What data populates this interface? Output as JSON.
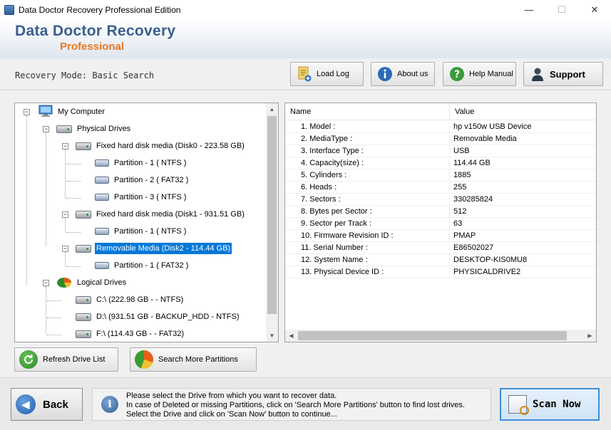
{
  "window": {
    "title": "Data Doctor Recovery Professional Edition",
    "min": "—",
    "max": "☐",
    "close": "✕"
  },
  "brand": {
    "name": "Data Doctor Recovery",
    "edition": "Professional"
  },
  "mode": {
    "text": "Recovery Mode: Basic Search"
  },
  "toolbar": {
    "load_log": "Load Log",
    "about": "About us",
    "help": "Help Manual",
    "support": "Support"
  },
  "tree": {
    "my_computer": "My Computer",
    "physical_drives": "Physical Drives",
    "disk0": "Fixed hard disk media (Disk0 - 223.58 GB)",
    "disk0_p1": "Partition - 1 ( NTFS )",
    "disk0_p2": "Partition - 2 ( FAT32 )",
    "disk0_p3": "Partition - 3 ( NTFS )",
    "disk1": "Fixed hard disk media (Disk1 - 931.51 GB)",
    "disk1_p1": "Partition - 1 ( NTFS )",
    "disk2": "Removable Media (Disk2 - 114.44 GB)",
    "disk2_p1": "Partition - 1 ( FAT32 )",
    "logical_drives": "Logical Drives",
    "c": "C:\\ (222.98 GB -  - NTFS)",
    "d": "D:\\ (931.51 GB - BACKUP_HDD - NTFS)",
    "f": "F:\\ (114.43 GB -  - FAT32)"
  },
  "details": {
    "col_name": "Name",
    "col_value": "Value",
    "rows": [
      {
        "name": "1. Model :",
        "value": "hp v150w USB Device"
      },
      {
        "name": "2. MediaType :",
        "value": "Removable Media"
      },
      {
        "name": "3. Interface Type :",
        "value": "USB"
      },
      {
        "name": "4. Capacity(size) :",
        "value": "114.44 GB"
      },
      {
        "name": "5. Cylinders :",
        "value": "1885"
      },
      {
        "name": "6. Heads :",
        "value": "255"
      },
      {
        "name": "7. Sectors :",
        "value": "330285824"
      },
      {
        "name": "8. Bytes per Sector :",
        "value": "512"
      },
      {
        "name": "9. Sector per Track :",
        "value": "63"
      },
      {
        "name": "10. Firmware Revision ID :",
        "value": "PMAP"
      },
      {
        "name": "11. Serial Number :",
        "value": "E86502027"
      },
      {
        "name": "12. System Name :",
        "value": "DESKTOP-KIS0MU8"
      },
      {
        "name": "13. Physical Device ID :",
        "value": "PHYSICALDRIVE2"
      }
    ]
  },
  "actions": {
    "refresh": "Refresh Drive List",
    "search_more": "Search More Partitions"
  },
  "footer": {
    "back": "Back",
    "info_line1": "Please select the Drive from which you want to recover data.",
    "info_line2": "In case of Deleted or missing Partitions, click on 'Search More Partitions' button to find lost drives.",
    "info_line3": "Select the Drive and click on 'Scan Now' button to continue...",
    "scan": "Scan Now"
  },
  "colors": {
    "brand_blue": "#3a5f8f",
    "brand_orange": "#e87722",
    "selection": "#0078d7"
  }
}
